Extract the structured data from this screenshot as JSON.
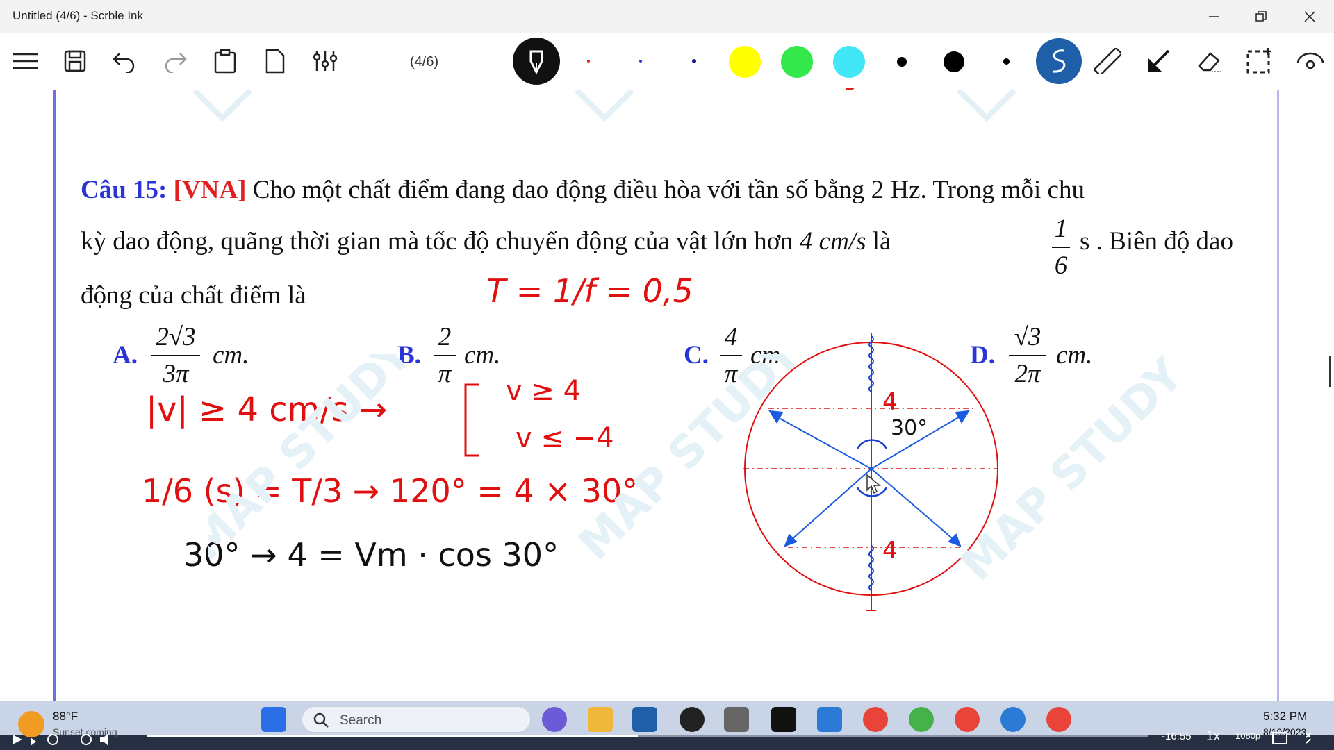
{
  "window": {
    "title": "Untitled (4/6) - Scrble Ink"
  },
  "toolbar": {
    "page_indicator": "(4/6)"
  },
  "colors": {
    "pen_palette": [
      "#e02020",
      "#2a35d8",
      "#1a1aa0",
      "#ffff00",
      "#33e84a",
      "#41e6f7",
      "#000000"
    ],
    "accent": "#1e5fa8",
    "ink_red": "#e01010"
  },
  "question": {
    "label": "Câu 15:",
    "tag": "[VNA]",
    "line1": "Cho một chất điểm đang dao động điều hòa với tần số bằng 2 Hz. Trong mỗi chu",
    "line2a": "kỳ dao động, quãng thời gian mà tốc độ chuyển động của vật lớn hơn",
    "line2_speed": "4 cm/s",
    "line2b": "là",
    "line2_frac_num": "1",
    "line2_frac_den": "6",
    "line2c": "s . Biên độ dao",
    "line3": "động của chất điểm là"
  },
  "options": [
    {
      "letter": "A.",
      "num": "2√3",
      "den": "3π",
      "unit": "cm."
    },
    {
      "letter": "B.",
      "num": "2",
      "den": "π",
      "unit": "cm."
    },
    {
      "letter": "C.",
      "num": "4",
      "den": "π",
      "unit": "cm."
    },
    {
      "letter": "D.",
      "num": "√3",
      "den": "2π",
      "unit": "cm."
    }
  ],
  "handwriting": {
    "period": "T = 1/f = 0,5",
    "speed_cond": "|v| ≥ 4 cm/s →",
    "v_ge": "v ≥ 4",
    "v_le": "v ≤ −4",
    "frac_line": "1/6 (s) = T/3 → 120° = 4 × 30°",
    "last_line": "30° → 4 = Vm · cos 30°",
    "circle_top_label": "4",
    "circle_angle": "30°",
    "circle_bottom_label": "4"
  },
  "taskbar": {
    "weather_temp": "88°F",
    "weather_sub": "Sunset coming",
    "search_placeholder": "Search",
    "time": "5:32 PM",
    "date": "8/19/2023"
  },
  "player": {
    "remaining": "-16:55",
    "speed": "1x",
    "quality": "1080p",
    "progress": 0.49
  }
}
